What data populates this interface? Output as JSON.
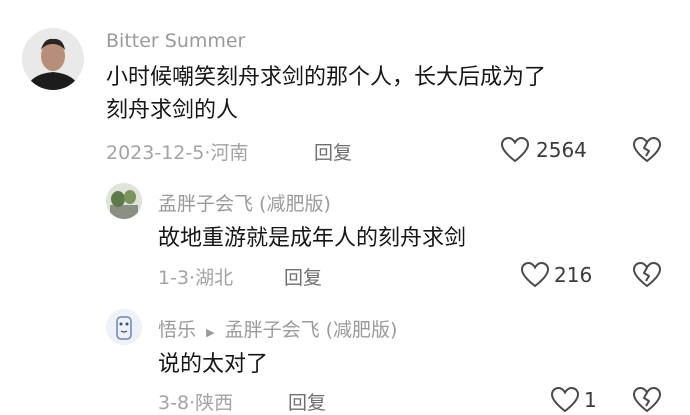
{
  "comments": [
    {
      "username": "Bitter Summer",
      "content_line1": "小时候嘲笑刻舟求剑的那个人，长大后成为了",
      "content_line2": "刻舟求剑的人",
      "date": "2023-12-5",
      "sep": "·",
      "location": "河南",
      "reply_label": "回复",
      "likes": "2564",
      "icons": {
        "like": "heart-icon",
        "dislike": "broken-heart-icon"
      }
    },
    {
      "username": "孟胖子会飞 (减肥版)",
      "content": "故地重游就是成年人的刻舟求剑",
      "date": "1-3",
      "sep": "·",
      "location": "湖北",
      "reply_label": "回复",
      "likes": "216"
    },
    {
      "username": "悟乐",
      "reply_to": "孟胖子会飞 (减肥版)",
      "content": "说的太对了",
      "date": "3-8",
      "sep": "·",
      "location": "陕西",
      "reply_label": "回复",
      "likes": "1"
    }
  ],
  "colors": {
    "text": "#161616",
    "meta": "#a3a3a3",
    "username": "#9a9a9a",
    "icon": "#4a4a4a"
  }
}
